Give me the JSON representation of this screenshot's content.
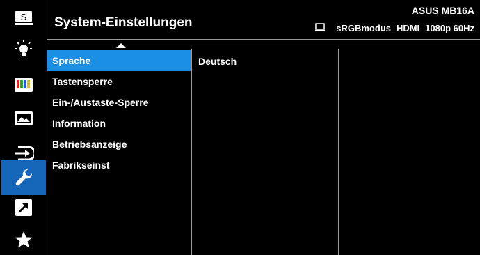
{
  "header": {
    "title": "System-Einstellungen",
    "model": "ASUS MB16A",
    "status": {
      "icon": "monitor-icon",
      "mode": "sRGBmodus",
      "input": "HDMI",
      "resolution": "1080p 60Hz"
    }
  },
  "sidebar": {
    "items": [
      {
        "name": "splendid",
        "icon": "splendid-s-icon",
        "active": false
      },
      {
        "name": "blue-light-filter",
        "icon": "light-bulb-icon",
        "active": false
      },
      {
        "name": "color",
        "icon": "color-bars-icon",
        "active": false
      },
      {
        "name": "image",
        "icon": "image-icon",
        "active": false
      },
      {
        "name": "input-select",
        "icon": "input-select-icon",
        "active": false
      },
      {
        "name": "system-setup",
        "icon": "wrench-icon",
        "active": true
      },
      {
        "name": "shortcut",
        "icon": "shortcut-arrow-icon",
        "active": false
      },
      {
        "name": "my-favorite",
        "icon": "star-icon",
        "active": false
      }
    ],
    "splendid_glyph": "S"
  },
  "menu": {
    "items": [
      {
        "label": "Sprache",
        "active": true
      },
      {
        "label": "Tastensperre",
        "active": false
      },
      {
        "label": "Ein-/Austaste-Sperre",
        "active": false
      },
      {
        "label": "Information",
        "active": false
      },
      {
        "label": "Betriebsanzeige",
        "active": false
      },
      {
        "label": "Fabrikseinst",
        "active": false
      }
    ]
  },
  "submenu": {
    "value": "Deutsch"
  },
  "colors": {
    "background": "#000000",
    "sidebar_active": "#1566b8",
    "menu_active": "#1a8fe3",
    "text": "#ffffff"
  }
}
